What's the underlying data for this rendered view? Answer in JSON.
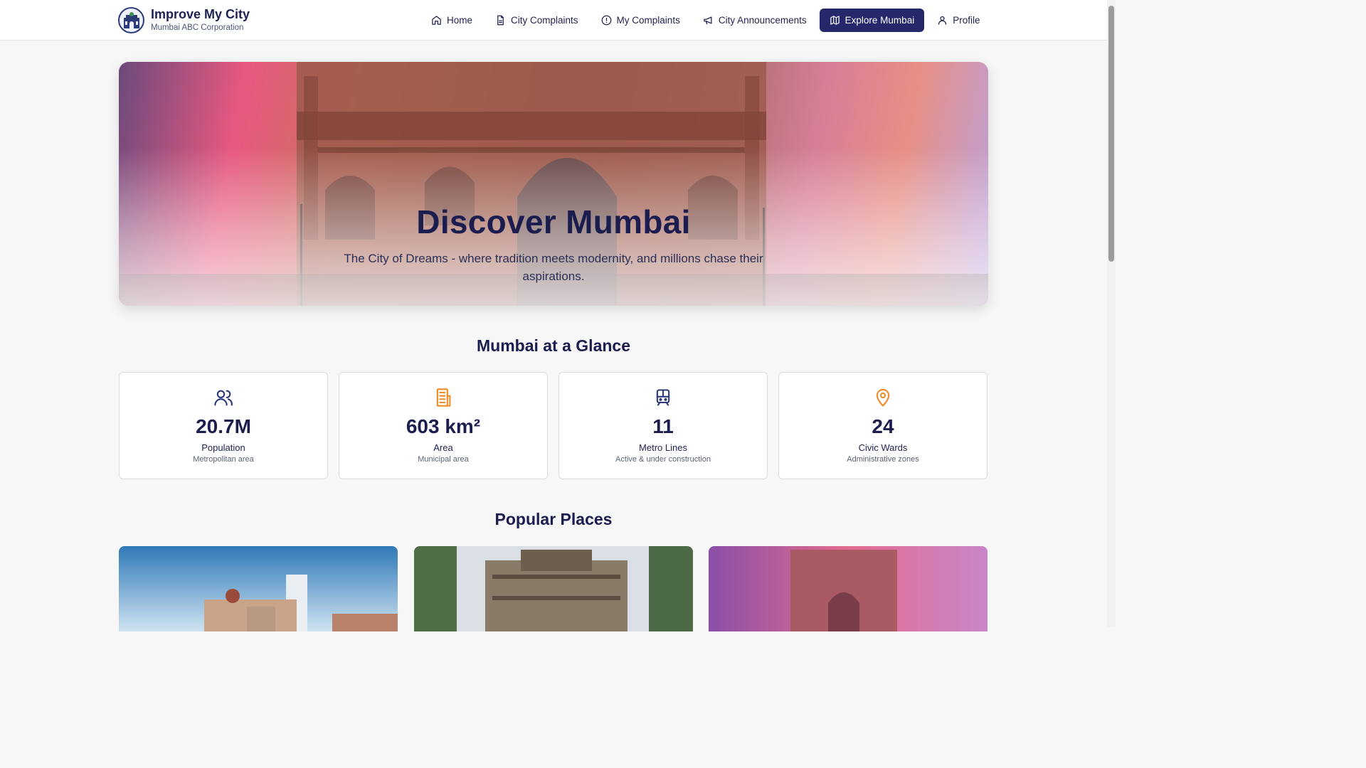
{
  "header": {
    "brand_title": "Improve My City",
    "brand_subtitle": "Mumbai ABC Corporation",
    "nav": [
      {
        "label": "Home",
        "icon": "home-icon"
      },
      {
        "label": "City Complaints",
        "icon": "document-icon"
      },
      {
        "label": "My Complaints",
        "icon": "alert-circle-icon"
      },
      {
        "label": "City Announcements",
        "icon": "megaphone-icon"
      },
      {
        "label": "Explore Mumbai",
        "icon": "map-icon",
        "active": true
      },
      {
        "label": "Profile",
        "icon": "user-icon"
      }
    ]
  },
  "hero": {
    "title": "Discover Mumbai",
    "subtitle": "The City of Dreams - where tradition meets modernity, and millions chase their aspirations."
  },
  "glance": {
    "title": "Mumbai at a Glance",
    "stats": [
      {
        "value": "20.7M",
        "label": "Population",
        "sub": "Metropolitan area",
        "icon": "users-icon",
        "color": "#2c3a7a"
      },
      {
        "value": "603 km²",
        "label": "Area",
        "sub": "Municipal area",
        "icon": "building-icon",
        "color": "#f08a24"
      },
      {
        "value": "11",
        "label": "Metro Lines",
        "sub": "Active & under construction",
        "icon": "train-icon",
        "color": "#2c3a7a"
      },
      {
        "value": "24",
        "label": "Civic Wards",
        "sub": "Administrative zones",
        "icon": "map-pin-icon",
        "color": "#f08a24"
      }
    ]
  },
  "places": {
    "title": "Popular Places"
  },
  "colors": {
    "primary": "#24286b",
    "accent": "#f08a24",
    "background": "#f7f7f8"
  }
}
